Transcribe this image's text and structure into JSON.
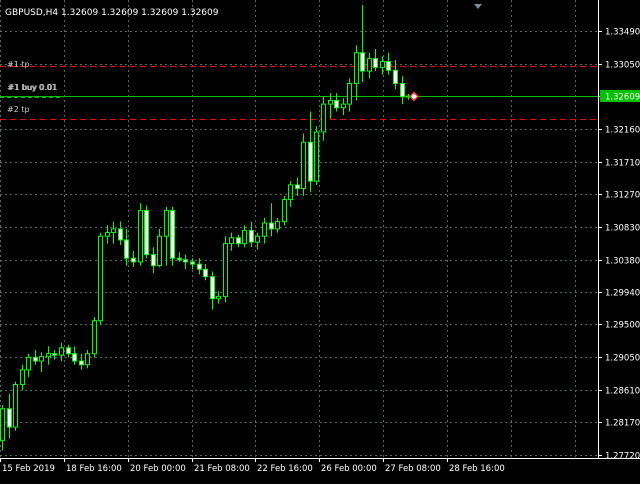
{
  "header": {
    "text": "GBPUSD,H4  1.32609 1.32609 1.32609 1.32609"
  },
  "price_tag": {
    "value": "1.32609",
    "color": "#00c000"
  },
  "order_labels": {
    "tp1": "#1 tp",
    "buy": "#1 buy 0.01",
    "tp2": "#2 tp"
  },
  "colors": {
    "background": "#000000",
    "grid": "#5a6a5a",
    "candle": "#00ff00",
    "bid_line": "#00c000",
    "tp_line": "#ff0000",
    "axis_text": "#ffffff"
  },
  "chart_data": {
    "type": "candlestick",
    "symbol": "GBPUSD",
    "timeframe": "H4",
    "y_ticks": [
      "1.33490",
      "1.33050",
      "1.32609",
      "1.32160",
      "1.31710",
      "1.31270",
      "1.30830",
      "1.30380",
      "1.29940",
      "1.29500",
      "1.29050",
      "1.28610",
      "1.28170",
      "1.27720"
    ],
    "x_ticks": [
      "15 Feb 2019",
      "18 Feb 16:00",
      "20 Feb 00:00",
      "21 Feb 08:00",
      "22 Feb 16:00",
      "26 Feb 00:00",
      "27 Feb 08:00",
      "28 Feb 16:00"
    ],
    "ylim": [
      1.2772,
      1.3385
    ],
    "levels": {
      "tp1": 1.3302,
      "current": 1.32609,
      "tp2": 1.323
    },
    "candles": [
      [
        1.2792,
        1.284,
        1.2778,
        1.2835
      ],
      [
        1.2835,
        1.2855,
        1.2795,
        1.281
      ],
      [
        1.281,
        1.2872,
        1.2805,
        1.2868
      ],
      [
        1.2868,
        1.2895,
        1.286,
        1.2888
      ],
      [
        1.2888,
        1.291,
        1.2878,
        1.2905
      ],
      [
        1.2905,
        1.2915,
        1.2895,
        1.29
      ],
      [
        1.29,
        1.2912,
        1.2885,
        1.2906
      ],
      [
        1.2906,
        1.292,
        1.2895,
        1.291
      ],
      [
        1.291,
        1.2915,
        1.2902,
        1.2908
      ],
      [
        1.2908,
        1.2925,
        1.29,
        1.2918
      ],
      [
        1.2918,
        1.2922,
        1.2905,
        1.291
      ],
      [
        1.291,
        1.292,
        1.2895,
        1.29
      ],
      [
        1.29,
        1.291,
        1.2888,
        1.2895
      ],
      [
        1.2895,
        1.2915,
        1.289,
        1.291
      ],
      [
        1.291,
        1.296,
        1.2905,
        1.2955
      ],
      [
        1.2955,
        1.3075,
        1.295,
        1.307
      ],
      [
        1.307,
        1.3085,
        1.306,
        1.3075
      ],
      [
        1.3075,
        1.309,
        1.306,
        1.308
      ],
      [
        1.308,
        1.309,
        1.3058,
        1.3065
      ],
      [
        1.3065,
        1.308,
        1.303,
        1.304
      ],
      [
        1.304,
        1.305,
        1.3028,
        1.3035
      ],
      [
        1.3035,
        1.3115,
        1.303,
        1.3105
      ],
      [
        1.3105,
        1.3112,
        1.304,
        1.3045
      ],
      [
        1.3045,
        1.3055,
        1.302,
        1.303
      ],
      [
        1.303,
        1.308,
        1.3028,
        1.307
      ],
      [
        1.307,
        1.311,
        1.303,
        1.3105
      ],
      [
        1.3105,
        1.311,
        1.303,
        1.304
      ],
      [
        1.304,
        1.3048,
        1.3035,
        1.3038
      ],
      [
        1.3038,
        1.3045,
        1.3025,
        1.3035
      ],
      [
        1.3035,
        1.304,
        1.3025,
        1.3032
      ],
      [
        1.3032,
        1.304,
        1.3018,
        1.3025
      ],
      [
        1.3025,
        1.3032,
        1.301,
        1.3015
      ],
      [
        1.3015,
        1.3022,
        1.297,
        1.2985
      ],
      [
        1.2985,
        1.2995,
        1.2978,
        1.2988
      ],
      [
        1.2988,
        1.307,
        1.298,
        1.306
      ],
      [
        1.306,
        1.3075,
        1.305,
        1.3068
      ],
      [
        1.3068,
        1.3072,
        1.3055,
        1.306
      ],
      [
        1.306,
        1.3085,
        1.3055,
        1.3078
      ],
      [
        1.3078,
        1.309,
        1.3055,
        1.3062
      ],
      [
        1.3062,
        1.3075,
        1.3052,
        1.307
      ],
      [
        1.307,
        1.3095,
        1.306,
        1.3088
      ],
      [
        1.3088,
        1.3115,
        1.307,
        1.308
      ],
      [
        1.308,
        1.3095,
        1.3075,
        1.309
      ],
      [
        1.309,
        1.3125,
        1.3085,
        1.312
      ],
      [
        1.312,
        1.3145,
        1.311,
        1.314
      ],
      [
        1.314,
        1.315,
        1.3125,
        1.3135
      ],
      [
        1.3135,
        1.321,
        1.3125,
        1.3198
      ],
      [
        1.3198,
        1.324,
        1.313,
        1.3145
      ],
      [
        1.3145,
        1.322,
        1.314,
        1.3212
      ],
      [
        1.3212,
        1.326,
        1.32,
        1.325
      ],
      [
        1.325,
        1.3265,
        1.323,
        1.3255
      ],
      [
        1.3255,
        1.3265,
        1.324,
        1.3245
      ],
      [
        1.3245,
        1.3258,
        1.3235,
        1.325
      ],
      [
        1.325,
        1.3285,
        1.324,
        1.3278
      ],
      [
        1.3278,
        1.333,
        1.3255,
        1.332
      ],
      [
        1.332,
        1.3385,
        1.328,
        1.3295
      ],
      [
        1.3295,
        1.332,
        1.3285,
        1.3312
      ],
      [
        1.3312,
        1.3325,
        1.3295,
        1.33
      ],
      [
        1.33,
        1.3315,
        1.329,
        1.3308
      ],
      [
        1.3308,
        1.332,
        1.329,
        1.3296
      ],
      [
        1.3296,
        1.331,
        1.327,
        1.3278
      ],
      [
        1.3278,
        1.3288,
        1.325,
        1.326
      ],
      [
        1.326,
        1.3264,
        1.3256,
        1.3261
      ]
    ]
  }
}
